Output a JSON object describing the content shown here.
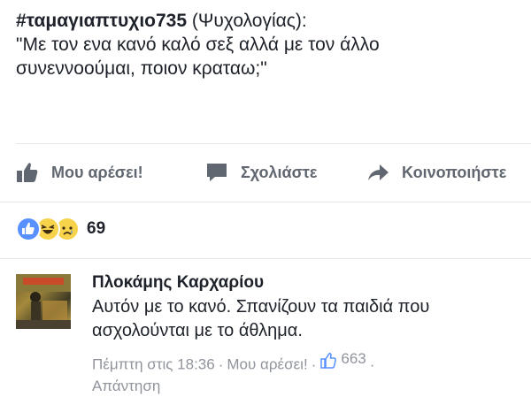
{
  "post": {
    "hashtag": "#ταμαγιαπτυχιο735",
    "source": " (Ψυχολογίας):",
    "line2": "\"Με τον ενα κανό καλό σεξ αλλά με τον άλλο",
    "line3": "συνεννοούμαι, ποιον κραταω;\""
  },
  "actions": {
    "like_label": "Μου αρέσει!",
    "comment_label": "Σχολιάστε",
    "share_label": "Κοινοποιήστε"
  },
  "reactions": {
    "types": [
      "like",
      "haha",
      "sad"
    ],
    "count": "69",
    "colors": {
      "like": "#5890ff",
      "face": "#f7d24b"
    }
  },
  "comment": {
    "author": "Πλοκάμης Καρχαρίου",
    "text_line1": "Αυτόν με το κανό. Σπανίζουν τα παιδιά που",
    "text_line2": "ασχολούνται με το άθλημα.",
    "timestamp": "Πέμπτη στις 18:36",
    "like_label": "Μου αρέσει!",
    "like_count": "663",
    "reply_label": "Απάντηση"
  },
  "colors": {
    "text": "#1d2129",
    "secondary": "#616770",
    "meta": "#90949c",
    "divider": "#e5e6e9"
  }
}
